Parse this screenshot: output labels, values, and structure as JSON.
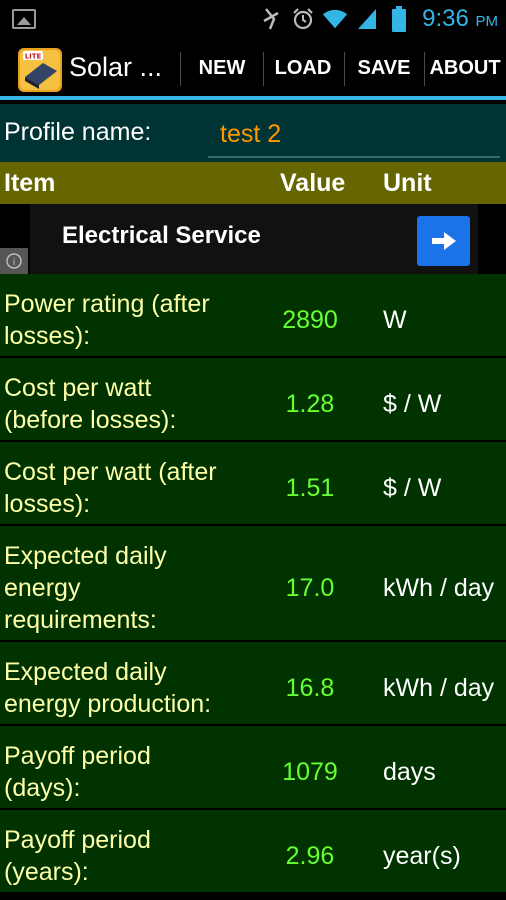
{
  "status_bar": {
    "time": "9:36",
    "ampm": "PM",
    "icons": [
      "gallery-icon",
      "mute-icon",
      "alarm-icon",
      "wifi-icon",
      "signal-icon",
      "battery-icon"
    ]
  },
  "action_bar": {
    "app_title": "Solar ...",
    "app_icon_badge": "LITE",
    "menu": [
      "NEW",
      "LOAD",
      "SAVE",
      "ABOUT"
    ]
  },
  "profile": {
    "label": "Profile name:",
    "value": "test 2"
  },
  "table_header": {
    "item": "Item",
    "value": "Value",
    "unit": "Unit"
  },
  "ad": {
    "text": "Electrical Service",
    "info": "i"
  },
  "rows": [
    {
      "item": [
        "Power rating (after",
        "losses):"
      ],
      "value": "2890",
      "unit": "W"
    },
    {
      "item": [
        "Cost per watt",
        "(before losses):"
      ],
      "value": "1.28",
      "unit": "$ / W"
    },
    {
      "item": [
        "Cost per watt (after",
        "losses):"
      ],
      "value": "1.51",
      "unit": "$ / W"
    },
    {
      "item": [
        "Expected daily",
        "energy",
        "requirements:"
      ],
      "value": "17.0",
      "unit": "kWh / day"
    },
    {
      "item": [
        "Expected daily",
        "energy production:"
      ],
      "value": "16.8",
      "unit": "kWh / day"
    },
    {
      "item": [
        "Payoff period",
        "(days):"
      ],
      "value": "1079",
      "unit": "days"
    },
    {
      "item": [
        "Payoff period",
        "(years):"
      ],
      "value": "2.96",
      "unit": "year(s)"
    }
  ],
  "colors": {
    "accent": "#33b5e5",
    "profile_bg": "#003333",
    "header_bg": "#666600",
    "row_bg": "#003300",
    "item_text": "#ffffaa",
    "value_text": "#66ff33",
    "profile_value_text": "#ff9900"
  }
}
